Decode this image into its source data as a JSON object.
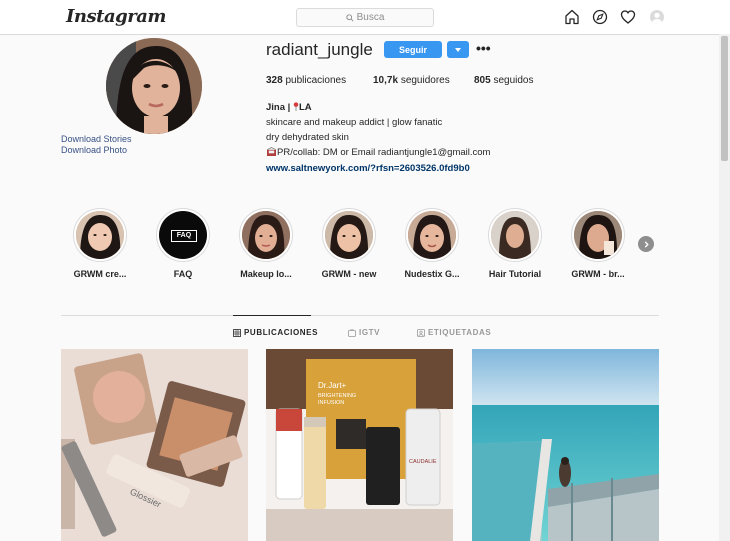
{
  "header": {
    "logo_text": "Instagram",
    "search_placeholder": "Busca",
    "nav_icons": [
      "home-icon",
      "explore-icon",
      "heart-icon",
      "profile-avatar"
    ]
  },
  "profile": {
    "username": "radiant_jungle",
    "follow_label": "Seguir",
    "download_stories": "Download Stories",
    "download_photo": "Download Photo",
    "stats": {
      "posts_count": "328",
      "posts_label": "publicaciones",
      "followers_count": "10,7k",
      "followers_label": "seguidores",
      "following_count": "805",
      "following_label": "seguidos"
    },
    "bio": {
      "name": "Jina | ",
      "location": "LA",
      "line1": "skincare and makeup addict | glow fanatic",
      "line2": "dry dehydrated skin",
      "line3": "PR/collab: DM or Email radiantjungle1@gmail.com",
      "link": "www.saltnewyork.com/?rfsn=2603526.0fd9b0"
    }
  },
  "highlights": [
    {
      "label": "GRWM cre..."
    },
    {
      "label": "FAQ",
      "badge": "FAQ"
    },
    {
      "label": "Makeup lo..."
    },
    {
      "label": "GRWM - new"
    },
    {
      "label": "Nudestix G..."
    },
    {
      "label": "Hair Tutorial"
    },
    {
      "label": "GRWM - br..."
    }
  ],
  "tabs": [
    {
      "label": "PUBLICACIONES",
      "active": true
    },
    {
      "label": "IGTV",
      "active": false
    },
    {
      "label": "ETIQUETADAS",
      "active": false
    }
  ],
  "posts": [
    {
      "brand_text": "Glossier"
    },
    {
      "brand_text": "Dr.Jart+",
      "sub_text": "BRIGHTENING INFUSION",
      "product_text": "CAUDALIE"
    },
    {
      "brand_text": ""
    }
  ],
  "colors": {
    "accent": "#3897f0",
    "link": "#385185",
    "text": "#262626"
  }
}
